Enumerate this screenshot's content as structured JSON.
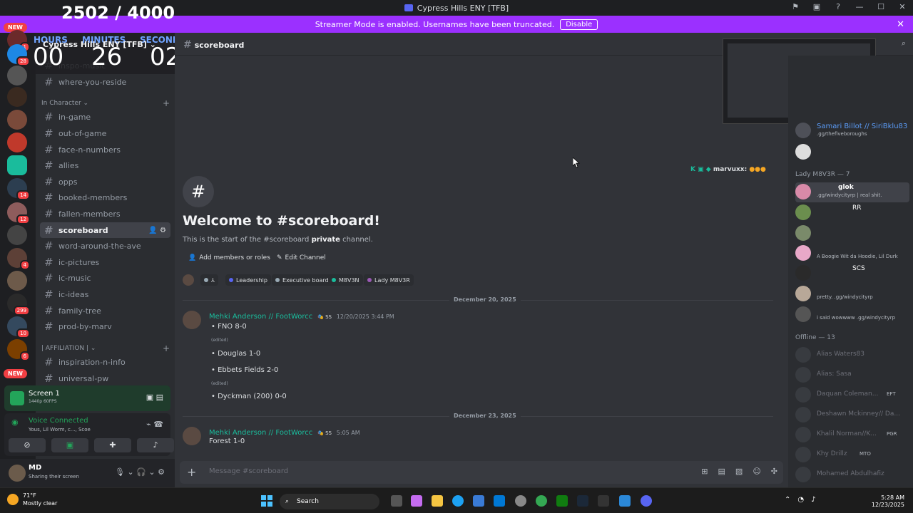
{
  "window": {
    "title": "Cypress Hills ENY [TFB]",
    "controls": [
      "—",
      "☐",
      "✕"
    ]
  },
  "banner": {
    "text": "Streamer Mode is enabled. Usernames have been truncated.",
    "button": "Disable"
  },
  "overlay": {
    "score": "2502 / 4000",
    "hours_label": "HOURS",
    "hours": "00",
    "minutes_label": "MINUTES",
    "minutes": "26",
    "seconds_label": "SECONDS",
    "seconds": "02"
  },
  "server": {
    "name": "Cypress Hills ENY [TFB]"
  },
  "rail": {
    "new_label": "NEW",
    "badges": [
      "1",
      "28",
      "14",
      "12",
      "4",
      "299",
      "10",
      "6"
    ]
  },
  "channels": {
    "top": [
      "inspo-music",
      "where-you-reside"
    ],
    "category_in_character": "In Character",
    "in_character": [
      "in-game",
      "out-of-game",
      "face-n-numbers",
      "allies",
      "opps",
      "booked-members",
      "fallen-members",
      "scoreboard",
      "word-around-the-ave",
      "ic-pictures",
      "ic-music",
      "ic-ideas",
      "family-tree",
      "prod-by-marv"
    ],
    "category_affiliation": "| AFFILIATION |",
    "affiliation": [
      "inspiration-n-info",
      "universal-pw"
    ]
  },
  "screen_share": {
    "title": "Screen 1",
    "quality": "1440p 60FPS"
  },
  "voice": {
    "status": "Voice Connected",
    "members": "Yous, Lil Worm, c..., Scoe"
  },
  "user": {
    "name": "MD",
    "status": "Sharing their screen"
  },
  "header": {
    "channel": "scoreboard"
  },
  "welcome": {
    "title": "Welcome to #scoreboard!",
    "desc_prefix": "This is the start of the #scoreboard ",
    "desc_bold": "private",
    "desc_suffix": " channel.",
    "add_members": "Add members or roles",
    "edit_channel": "Edit Channel",
    "chips": [
      {
        "label": "Leadership",
        "color": "#5865f2"
      },
      {
        "label": "Executive board",
        "color": "#99aab5"
      },
      {
        "label": "M8V3N",
        "color": "#1abc9c"
      },
      {
        "label": "Lady M8V3R",
        "color": "#9b59b6"
      }
    ]
  },
  "typing_user": "marvuxx:",
  "dates": {
    "d1": "December 20, 2025",
    "d2": "December 23, 2025"
  },
  "messages": [
    {
      "author": "Mehki Anderson // FootWorcc",
      "tag": "SS",
      "time": "12/20/2025 3:44 PM",
      "lines": [
        "FNO 8-0",
        "Douglas 1-0",
        "Ebbets Fields 2-0",
        "Dyckman (200) 0-0"
      ],
      "edited_label": "(edited)"
    },
    {
      "author": "Mehki Anderson // FootWorcc",
      "tag": "SS",
      "time": "5:05 AM",
      "lines": [
        "Forest 1-0"
      ]
    }
  ],
  "composer": {
    "placeholder": "Message #scoreboard"
  },
  "members": {
    "top": [
      {
        "name": "Samari Billot // SiriBklu83",
        "status": ".gg/thefiveboroughs"
      }
    ],
    "group_label": "Lady M8V3R — 7",
    "group": [
      {
        "name": "glok",
        "status": ".gg/windycityrp | real shit."
      },
      {
        "name": "RR",
        "status": ""
      },
      {
        "name": "",
        "status": ""
      },
      {
        "name": "",
        "status": "A Boogie Wit da Hoodie, Lil Durk"
      },
      {
        "name": "SCS",
        "status": ""
      },
      {
        "name": "",
        "status": "pretty. .gg/windycityrp"
      },
      {
        "name": "",
        "status": "i said wowwww .gg/windycityrp"
      }
    ],
    "offline_label": "Offline — 13",
    "offline": [
      {
        "name": "Alias Waters83",
        "tag": ""
      },
      {
        "name": "Alias: Sasa",
        "tag": ""
      },
      {
        "name": "Daquan Coleman...",
        "tag": "EFT"
      },
      {
        "name": "Deshawn Mckinney// Da...",
        "tag": ""
      },
      {
        "name": "Khalil Norman//K...",
        "tag": "PGR"
      },
      {
        "name": "Khy Drillz",
        "tag": "MTO"
      },
      {
        "name": "Mohamed Abdulhafiz",
        "tag": ""
      }
    ]
  },
  "taskbar": {
    "temp": "71°F",
    "weather": "Mostly clear",
    "search": "Search",
    "time": "5:28 AM",
    "date": "12/23/2025"
  }
}
